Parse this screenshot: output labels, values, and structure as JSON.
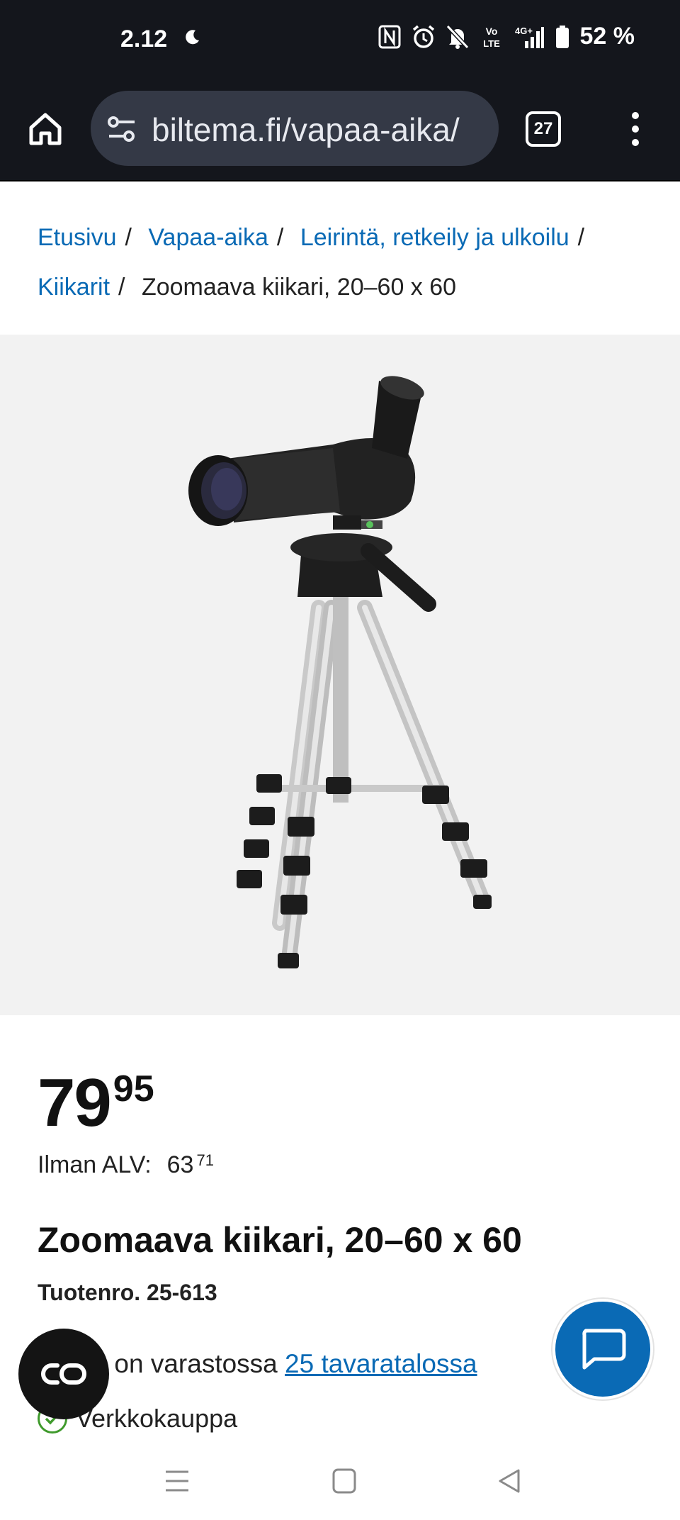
{
  "status_bar": {
    "time": "2.12",
    "battery": "52 %",
    "icons": [
      "moon-icon",
      "nfc-icon",
      "alarm-icon",
      "mute-icon",
      "volte-icon",
      "signal-4g-icon",
      "battery-icon"
    ]
  },
  "browser": {
    "url": "biltema.fi/vapaa-aika/",
    "tab_count": "27"
  },
  "breadcrumb": {
    "items": [
      "Etusivu",
      "Vapaa-aika",
      "Leirintä, retkeily ja ulkoilu",
      "Kiikarit"
    ],
    "current": "Zoomaava kiikari, 20–60 x 60"
  },
  "product": {
    "price_main": "79",
    "price_decimals": "95",
    "vat_label": "Ilman ALV:",
    "vat_main": "63",
    "vat_decimals": "71",
    "title": "Zoomaava kiikari, 20–60 x 60",
    "sku": "Tuotenro. 25-613",
    "stock_prefix": "tta on varastossa",
    "stock_link": "25 tavaratalossa",
    "online": "Verkkokauppa"
  },
  "colors": {
    "brand_blue": "#0a6ab5",
    "check_green": "#3f9a2c",
    "chrome_dark": "#14161c"
  }
}
